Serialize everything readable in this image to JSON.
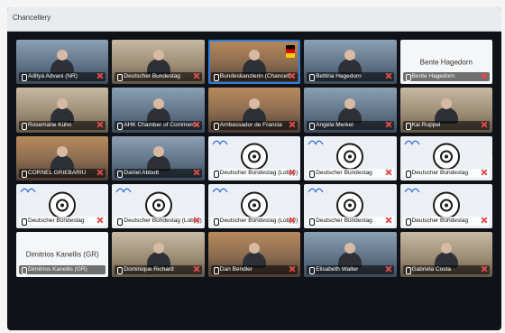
{
  "window": {
    "title": "Chancellery"
  },
  "tiles": [
    {
      "id": "t1",
      "type": "video",
      "style": "",
      "name": "Aditya Advani (NR)",
      "muted": true
    },
    {
      "id": "t2",
      "type": "video",
      "style": "alt",
      "name": "Deutscher Bundestag",
      "muted": true
    },
    {
      "id": "t3",
      "type": "video",
      "style": "warm",
      "name": "Bundeskanzlerin (Chancellery)",
      "muted": true,
      "active": true,
      "flag": true
    },
    {
      "id": "t4",
      "type": "video",
      "style": "",
      "name": "Bettina Hagedorn",
      "muted": true
    },
    {
      "id": "t5",
      "type": "name",
      "name": "Bente Hagedorn",
      "muted": true
    },
    {
      "id": "t6",
      "type": "video",
      "style": "alt",
      "name": "Rosemarie Kühn",
      "muted": true
    },
    {
      "id": "t7",
      "type": "video",
      "style": "",
      "name": "AHK Chamber of Commerce",
      "muted": true
    },
    {
      "id": "t8",
      "type": "video",
      "style": "warm",
      "name": "Ambassador de Francia",
      "muted": true
    },
    {
      "id": "t9",
      "type": "video",
      "style": "",
      "name": "Angela Merkel",
      "muted": true
    },
    {
      "id": "t10",
      "type": "video",
      "style": "alt",
      "name": "Kai Ruppel",
      "muted": true
    },
    {
      "id": "t11",
      "type": "video",
      "style": "warm",
      "name": "CORNEL GRIEBARIU",
      "muted": true
    },
    {
      "id": "t12",
      "type": "video",
      "style": "",
      "name": "Daniel Abbott",
      "muted": true
    },
    {
      "id": "t13",
      "type": "audio",
      "name": "Deutscher Bundestag (Lobby)",
      "muted": true,
      "logo": true,
      "avatar": true
    },
    {
      "id": "t14",
      "type": "audio",
      "name": "Deutscher Bundestag",
      "muted": true,
      "logo": true
    },
    {
      "id": "t15",
      "type": "audio",
      "name": "Deutscher Bundestag",
      "muted": true,
      "logo": true,
      "arrow": true
    },
    {
      "id": "t16",
      "type": "audio",
      "name": "Deutscher Bundestag",
      "muted": true,
      "logo": true
    },
    {
      "id": "t17",
      "type": "audio",
      "name": "Deutscher Bundestag (Lobby)",
      "muted": true,
      "logo": true
    },
    {
      "id": "t18",
      "type": "audio",
      "name": "Deutscher Bundestag (Lobby)",
      "muted": true,
      "logo": true
    },
    {
      "id": "t19",
      "type": "audio",
      "name": "Deutscher Bundestag",
      "muted": true,
      "logo": true
    },
    {
      "id": "t20",
      "type": "audio",
      "name": "Deutscher Bundestag",
      "muted": true,
      "logo": true
    },
    {
      "id": "t21",
      "type": "name",
      "name": "Dimitrios Kanellis (GR)",
      "muted": false
    },
    {
      "id": "t22",
      "type": "video",
      "style": "alt",
      "name": "Dominique Richard",
      "muted": true
    },
    {
      "id": "t23",
      "type": "video",
      "style": "warm",
      "name": "Dan Bendler",
      "muted": true
    },
    {
      "id": "t24",
      "type": "video",
      "style": "",
      "name": "Elisabeth Walter",
      "muted": true
    },
    {
      "id": "t25",
      "type": "video",
      "style": "alt",
      "name": "Gabriela Costa",
      "muted": true
    }
  ]
}
